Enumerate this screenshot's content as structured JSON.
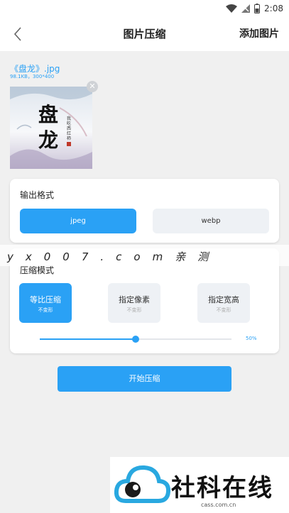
{
  "status_bar": {
    "time": "2:08"
  },
  "app_bar": {
    "title": "图片压缩",
    "action_label": "添加图片",
    "back_icon": "chevron-left-icon"
  },
  "image": {
    "filename": "《盘龙》.jpg",
    "info": "98.1KB，300*400",
    "cover_title": "盘龙",
    "cover_author": "我吃西红柿"
  },
  "output_format": {
    "title": "输出格式",
    "options": [
      {
        "label": "jpeg",
        "selected": true
      },
      {
        "label": "webp",
        "selected": false
      }
    ]
  },
  "compress_mode": {
    "title": "压缩模式",
    "modes": [
      {
        "label": "等比压缩",
        "sub": "不变形",
        "selected": true
      },
      {
        "label": "指定像素",
        "sub": "不变形",
        "selected": false
      },
      {
        "label": "指定宽高",
        "sub": "不变形",
        "selected": false
      }
    ],
    "quality_fraction": 0.5,
    "quality_label": "50%"
  },
  "start_button": {
    "label": "开始压缩"
  },
  "watermark": {
    "text": "yx007.com亲测"
  },
  "logo": {
    "text": "社科在线",
    "url": "cass.com.cn"
  },
  "colors": {
    "accent": "#2aa1f5",
    "inactive": "#eef1f5",
    "background": "#f0f0f0"
  }
}
